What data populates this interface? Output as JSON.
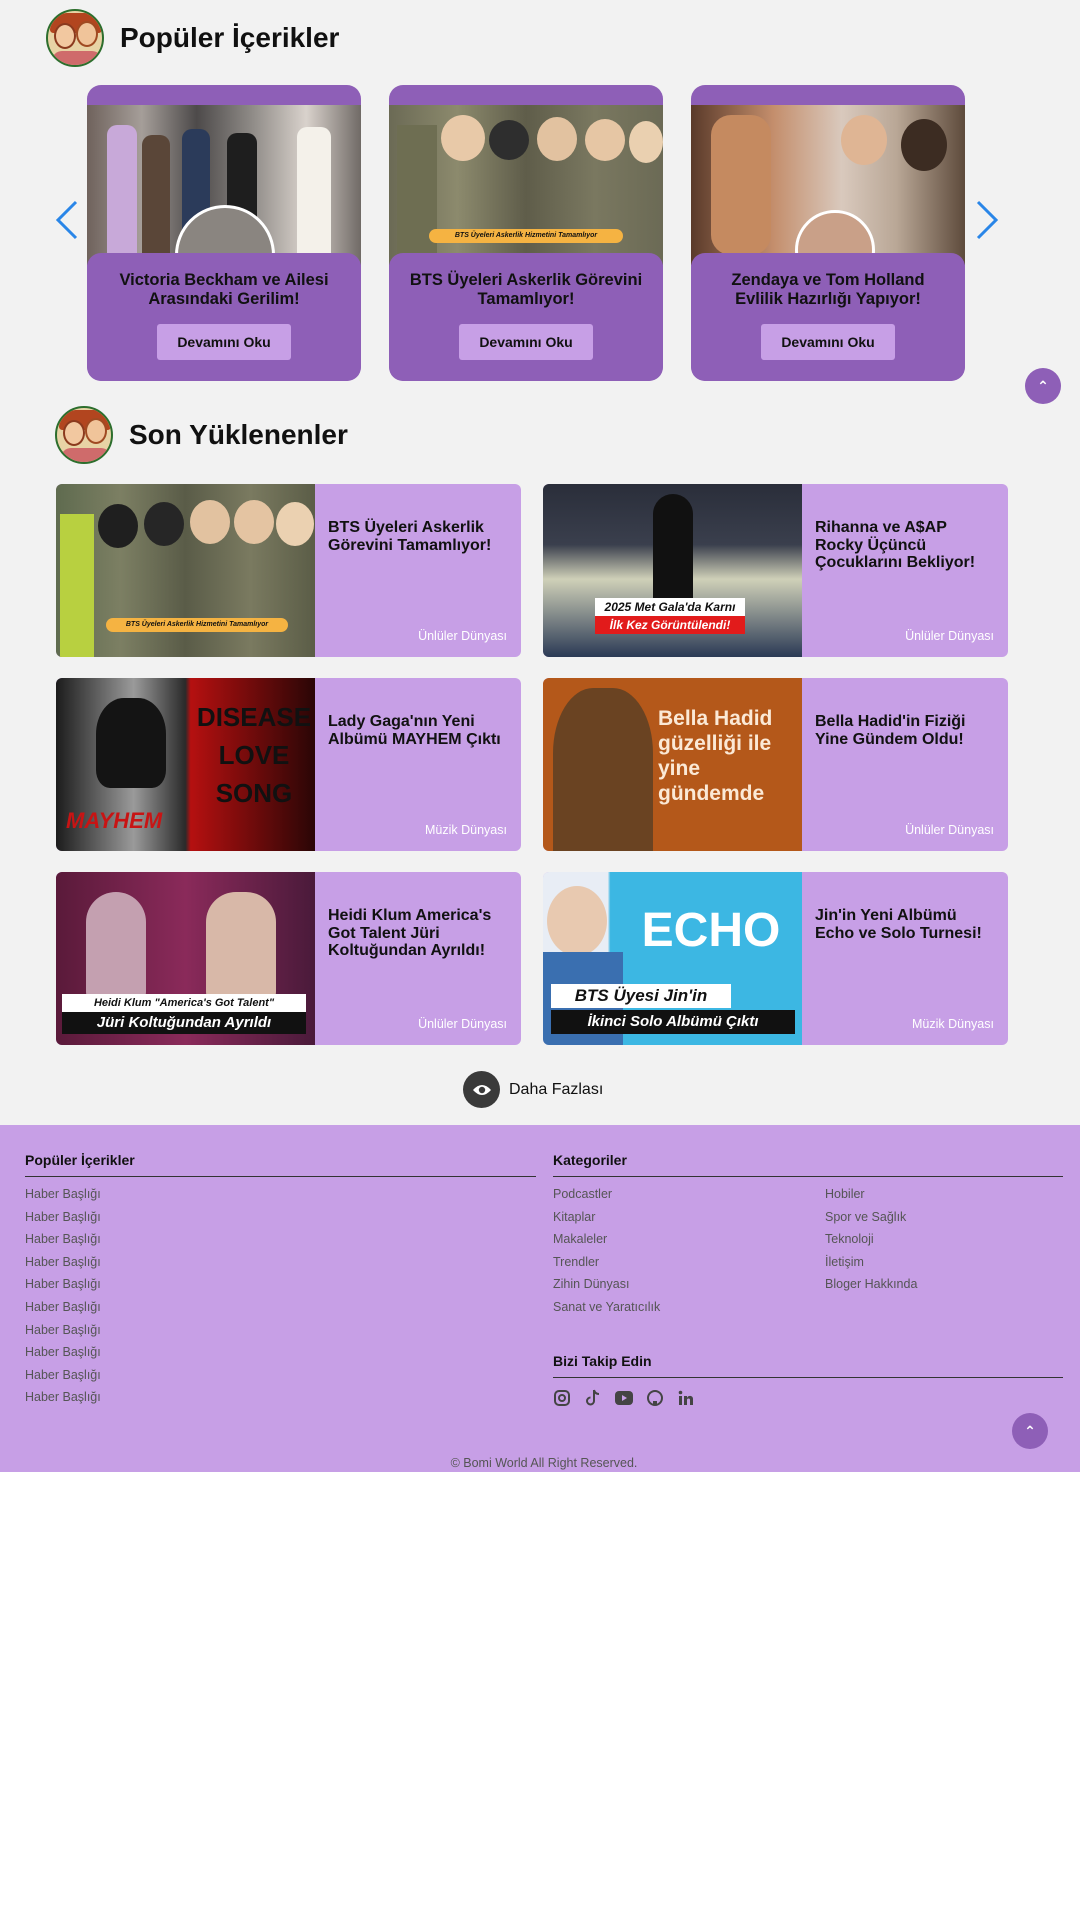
{
  "popular": {
    "heading": "Popüler İçerikler",
    "cards": [
      {
        "title": "Victoria Beckham ve Ailesi Arasındaki Gerilim!",
        "button": "Devamını Oku"
      },
      {
        "title": "BTS Üyeleri Askerlik Görevini Tamamlıyor!",
        "button": "Devamını Oku",
        "badge": "BTS Üyeleri Askerlik Hizmetini Tamamlıyor"
      },
      {
        "title": "Zendaya ve Tom Holland Evlilik Hazırlığı Yapıyor!",
        "button": "Devamını Oku"
      }
    ]
  },
  "latest": {
    "heading": "Son Yüklenenler",
    "cards": [
      {
        "title": "BTS Üyeleri Askerlik Görevini Tamamlıyor!",
        "category": "Ünlüler Dünyası",
        "overlay1": "BTS Üyeleri Askerlik Hizmetini Tamamlıyor"
      },
      {
        "title": "Rihanna ve A$AP Rocky Üçüncü Çocuklarını Bekliyor!",
        "category": "Ünlüler Dünyası",
        "overlay1": "2025 Met Gala'da Karnı",
        "overlay2": "İlk Kez Görüntülendi!"
      },
      {
        "title": "Lady Gaga'nın Yeni Albümü MAYHEM Çıktı",
        "category": "Müzik Dünyası",
        "overlay1": "MAYHEM",
        "overlay2": "DISEASE LOVE SONG"
      },
      {
        "title": "Bella Hadid'in Fiziği Yine Gündem Oldu!",
        "category": "Ünlüler Dünyası",
        "overlay1": "Bella Hadid güzelliği ile yine gündemde"
      },
      {
        "title": "Heidi Klum America's Got Talent Jüri Koltuğundan Ayrıldı!",
        "category": "Ünlüler Dünyası",
        "overlay1": "Heidi Klum \"America's Got Talent\"",
        "overlay2": "Jüri Koltuğundan Ayrıldı"
      },
      {
        "title": "Jin'in Yeni Albümü Echo ve Solo Turnesi!",
        "category": "Müzik Dünyası",
        "overlay1": "ECHO",
        "overlay2": "BTS Üyesi Jin'in",
        "overlay3": "İkinci Solo Albümü Çıktı"
      }
    ],
    "more_label": "Daha Fazlası"
  },
  "footer": {
    "popular_title": "Popüler İçerikler",
    "popular_links": [
      "Haber Başlığı",
      "Haber Başlığı",
      "Haber Başlığı",
      "Haber Başlığı",
      "Haber Başlığı",
      "Haber Başlığı",
      "Haber Başlığı",
      "Haber Başlığı",
      "Haber Başlığı",
      "Haber Başlığı"
    ],
    "categories_title": "Kategoriler",
    "categories_col1": [
      "Podcastler",
      "Kitaplar",
      "Makaleler",
      "Trendler",
      "Zihin Dünyası",
      "Sanat ve Yaratıcılık"
    ],
    "categories_col2": [
      "Hobiler",
      "Spor ve Sağlık",
      "Teknoloji",
      "İletişim",
      "Bloger Hakkında"
    ],
    "follow_title": "Bizi Takip Edin",
    "social_icons": [
      "instagram-icon",
      "tiktok-icon",
      "youtube-icon",
      "github-icon",
      "linkedin-icon"
    ],
    "copyright": "© Bomi World All Right Reserved."
  },
  "colors": {
    "accent_dark": "#8e5fb7",
    "accent_light": "#c79fe6",
    "arrow_blue": "#2a86e8"
  }
}
